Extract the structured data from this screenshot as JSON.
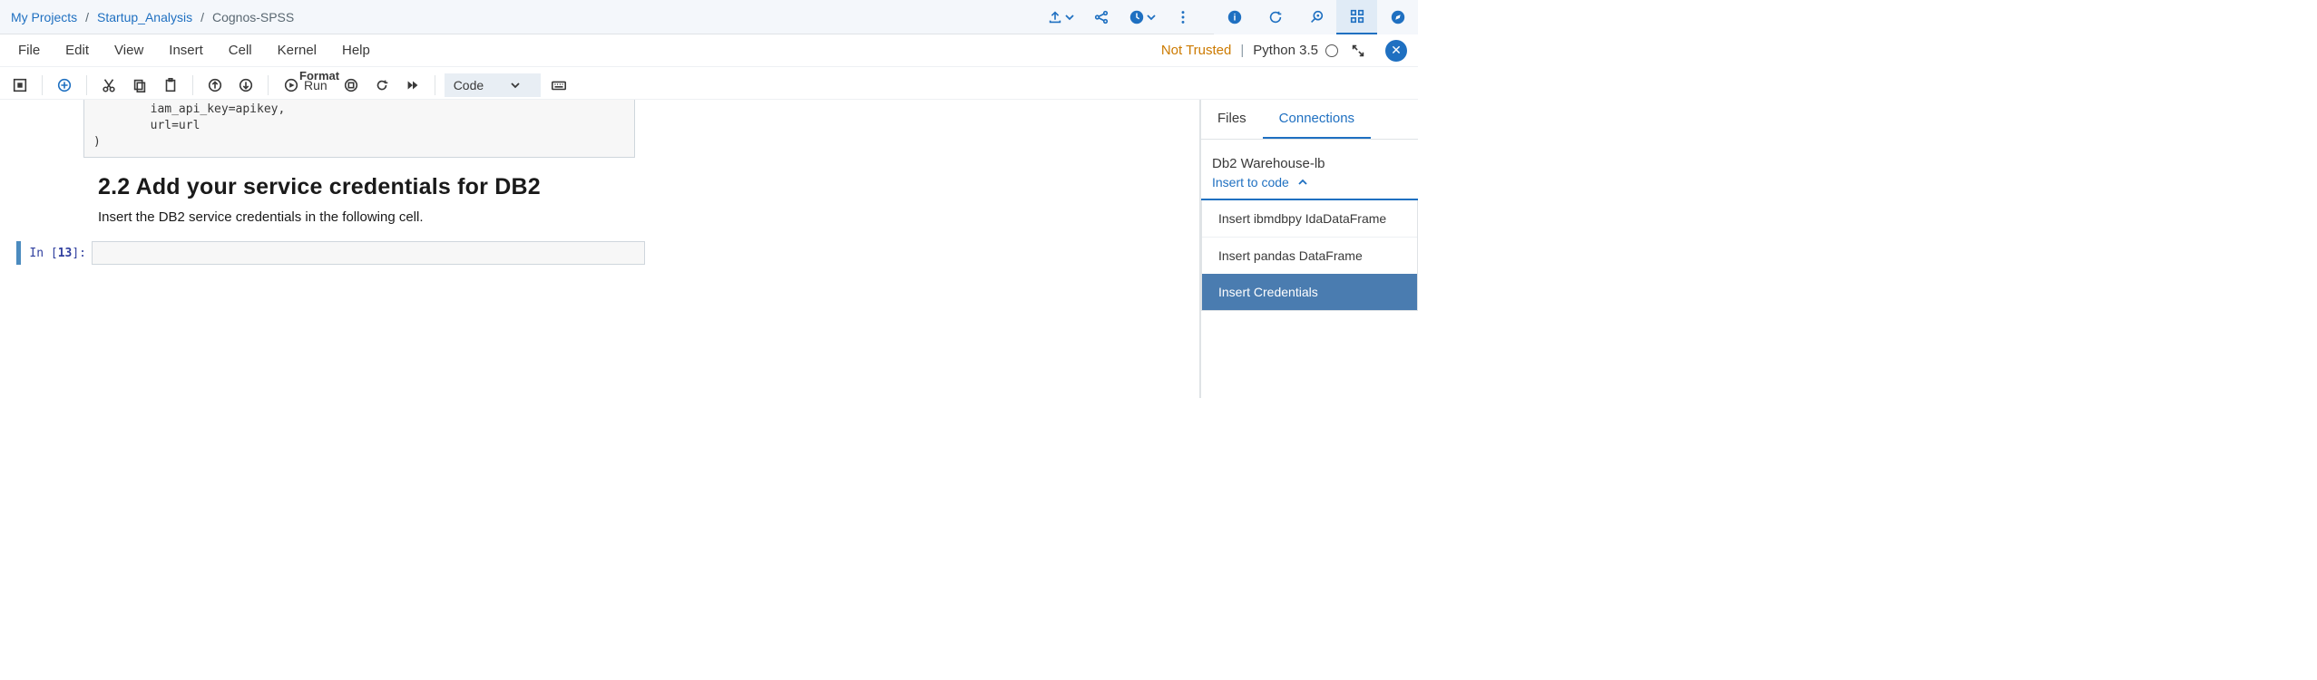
{
  "breadcrumb": {
    "items": [
      "My Projects",
      "Startup_Analysis",
      "Cognos-SPSS"
    ]
  },
  "menus": [
    "File",
    "Edit",
    "View",
    "Insert",
    "Cell",
    "Kernel",
    "Help"
  ],
  "status": {
    "trust": "Not Trusted",
    "kernel": "Python 3.5"
  },
  "format_label": "Format",
  "toolbar": {
    "run_label": "Run",
    "cell_type": "Code"
  },
  "notebook": {
    "code_tail_line1": "        iam_api_key=apikey,",
    "code_tail_line2": "        url=url",
    "code_tail_line3": ")",
    "heading": "2.2 Add your service credentials for DB2",
    "paragraph": "Insert the DB2 service credentials in the following cell.",
    "prompt_label": "In [",
    "prompt_n": "13",
    "prompt_close": "]:"
  },
  "sidepanel": {
    "tabs": [
      "Files",
      "Connections"
    ],
    "conn_name": "Db2 Warehouse-lb",
    "insert_label": "Insert to code",
    "items": [
      "Insert ibmdbpy IdaDataFrame",
      "Insert pandas DataFrame",
      "Insert Credentials"
    ]
  }
}
